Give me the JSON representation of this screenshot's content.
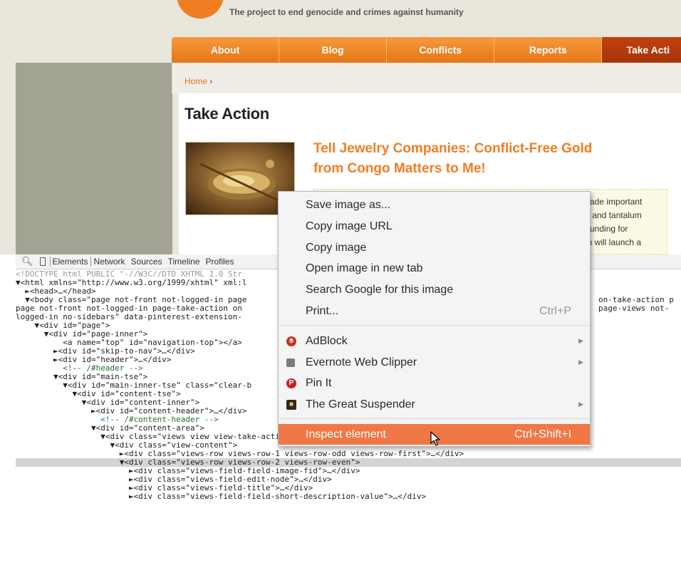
{
  "webpage": {
    "tagline": "The project to end genocide and crimes against humanity",
    "nav": [
      {
        "label": "About"
      },
      {
        "label": "Blog"
      },
      {
        "label": "Conflicts"
      },
      {
        "label": "Reports"
      },
      {
        "label": "Take Acti"
      }
    ],
    "breadcrumb": {
      "home": "Home",
      "separator": "›"
    },
    "page_title": "Take Action",
    "article": {
      "title_line1": "Tell Jewelry Companies: Conflict-Free Gold",
      "title_line2": "from Congo Matters to Me!",
      "desc_lines": [
        "made important",
        "n, and tantalum",
        "f funding for",
        "gh will launch a",
        ""
      ]
    }
  },
  "devtools": {
    "tabs": [
      "Elements",
      "Network",
      "Sources",
      "Timeline",
      "Profiles"
    ],
    "active_tab": "Elements",
    "lines": [
      "<!DOCTYPE html PUBLIC \"-//W3C//DTD XHTML 1.0 Str",
      "▼<html xmlns=\"http://www.w3.org/1999/xhtml\" xml:l",
      "  ►<head>…</head>",
      "  ▼<body class=\"page not-front not-logged-in page",
      "page not-front not-logged-in page-take-action on",
      "logged-in no-sidebars\" data-pinterest-extension-",
      "    ▼<div id=\"page\">",
      "      ▼<div id=\"page-inner\">",
      "          <a name=\"top\" id=\"navigation-top\"></a>",
      "        ►<div id=\"skip-to-nav\">…</div>",
      "        ►<div id=\"header\">…</div>",
      "          <!-- /#header -->",
      "        ▼<div id=\"main-tse\">",
      "          ▼<div id=\"main-inner-tse\" class=\"clear-b",
      "            ▼<div id=\"content-tse\">",
      "              ▼<div id=\"content-inner\">",
      "                ►<div id=\"content-header\">…</div>",
      "                  <!-- /#content-header -->",
      "                ▼<div id=\"content-area\">",
      "                  ▼<div class=\"views view view-take-action-list view-id-take_action_list view-display-id-page_1 view-dom-i",
      "                    ▼<div class=\"view-content\">",
      "                      ►<div class=\"views-row views-row-1 views-row-odd views-row-first\">…</div>",
      "                      ▼<div class=\"views-row views-row-2 views-row-even\">",
      "                        ►<div class=\"views-field-field-image-fid\">…</div>",
      "                        ►<div class=\"views-field-edit-node\">…</div>",
      "                        ►<div class=\"views-field-title\">…</div>",
      "                        ►<div class=\"views-field-field-short-description-value\">…</div>"
    ],
    "right_fragments": [
      {
        "line": 3,
        "text": "on-take-action p"
      },
      {
        "line": 4,
        "text": "page-views not-"
      }
    ],
    "partial_line": "▼<html ... >"
  },
  "context_menu": {
    "items": [
      {
        "label": "Save image as..."
      },
      {
        "label": "Copy image URL"
      },
      {
        "label": "Copy image"
      },
      {
        "label": "Open image in new tab"
      },
      {
        "label": "Search Google for this image"
      },
      {
        "label": "Print...",
        "shortcut": "Ctrl+P"
      },
      {
        "label": "AdBlock",
        "icon": "adblock-icon",
        "submenu": true
      },
      {
        "label": "Evernote Web Clipper",
        "icon": "evernote-icon",
        "submenu": true
      },
      {
        "label": "Pin It",
        "icon": "pinterest-icon"
      },
      {
        "label": "The Great Suspender",
        "icon": "suspender-icon",
        "submenu": true
      },
      {
        "label": "Inspect element",
        "shortcut": "Ctrl+Shift+I",
        "highlighted": true
      }
    ],
    "colors": {
      "highlight": "#f07746",
      "adblock": "#c8301f",
      "pinterest": "#cb2027"
    }
  },
  "colors": {
    "brand_orange": "#ef7e23",
    "nav_active": "#b13a0c"
  }
}
